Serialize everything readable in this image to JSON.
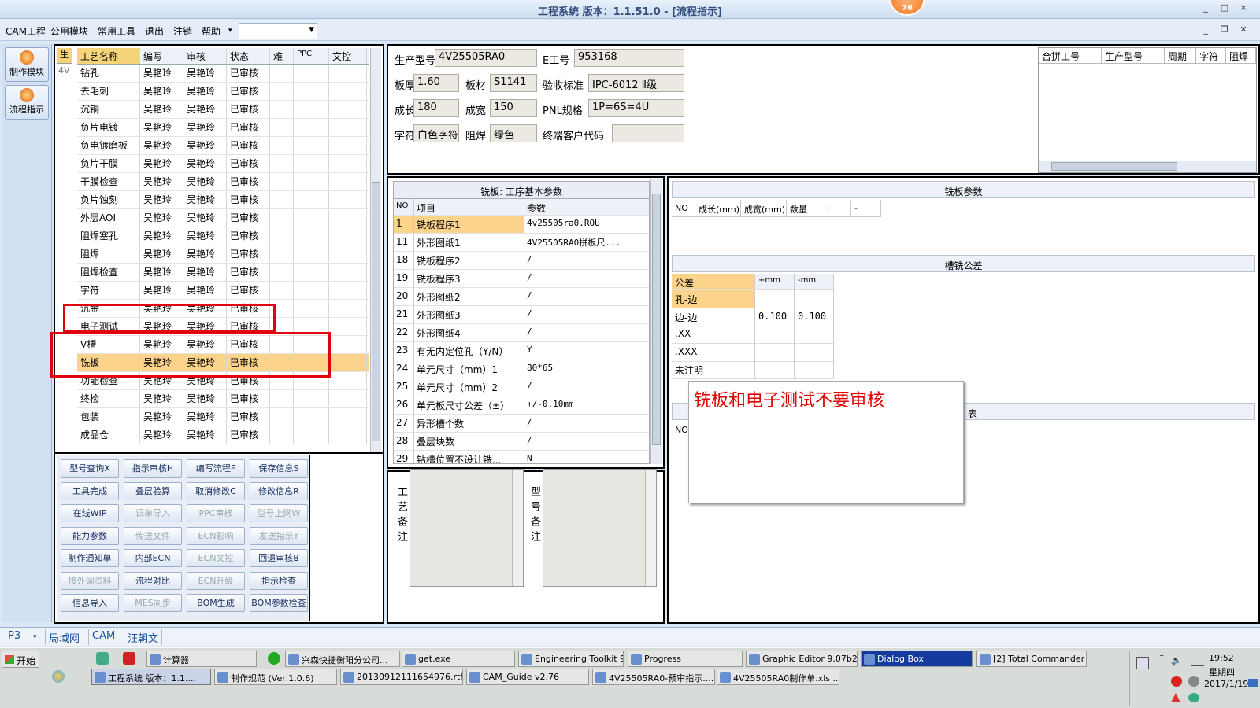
{
  "window": {
    "title": "工程系统    版本：1.1.51.0 - [流程指示]",
    "badge": "76",
    "controls": [
      "_",
      "□",
      "×"
    ]
  },
  "menubar": {
    "items": [
      "CAM工程",
      "公用模块",
      "常用工具",
      "退出",
      "注销",
      "帮助"
    ],
    "combo_value": ""
  },
  "leftbar": {
    "buttons": [
      "制作模块",
      "流程指示"
    ]
  },
  "strip": {
    "head": "生",
    "cell": "4V"
  },
  "process": {
    "headers": [
      "工艺名称",
      "编写",
      "审核",
      "状态",
      "难",
      "PPC",
      "文控"
    ],
    "rows": [
      [
        "钻孔",
        "吴艳玲",
        "吴艳玲",
        "已审核"
      ],
      [
        "去毛刺",
        "吴艳玲",
        "吴艳玲",
        "已审核"
      ],
      [
        "沉铜",
        "吴艳玲",
        "吴艳玲",
        "已审核"
      ],
      [
        "负片电镀",
        "吴艳玲",
        "吴艳玲",
        "已审核"
      ],
      [
        "负电镀磨板",
        "吴艳玲",
        "吴艳玲",
        "已审核"
      ],
      [
        "负片干膜",
        "吴艳玲",
        "吴艳玲",
        "已审核"
      ],
      [
        "干膜检查",
        "吴艳玲",
        "吴艳玲",
        "已审核"
      ],
      [
        "负片蚀刻",
        "吴艳玲",
        "吴艳玲",
        "已审核"
      ],
      [
        "外层AOI",
        "吴艳玲",
        "吴艳玲",
        "已审核"
      ],
      [
        "阻焊塞孔",
        "吴艳玲",
        "吴艳玲",
        "已审核"
      ],
      [
        "阻焊",
        "吴艳玲",
        "吴艳玲",
        "已审核"
      ],
      [
        "阻焊检查",
        "吴艳玲",
        "吴艳玲",
        "已审核"
      ],
      [
        "字符",
        "吴艳玲",
        "吴艳玲",
        "已审核"
      ],
      [
        "沉金",
        "吴艳玲",
        "吴艳玲",
        "已审核"
      ],
      [
        "电子测试",
        "吴艳玲",
        "吴艳玲",
        "已审核"
      ],
      [
        "V槽",
        "吴艳玲",
        "吴艳玲",
        "已审核"
      ],
      [
        "铣板",
        "吴艳玲",
        "吴艳玲",
        "已审核"
      ],
      [
        "功能检查",
        "吴艳玲",
        "吴艳玲",
        "已审核"
      ],
      [
        "终检",
        "吴艳玲",
        "吴艳玲",
        "已审核"
      ],
      [
        "包装",
        "吴艳玲",
        "吴艳玲",
        "已审核"
      ],
      [
        "成品仓",
        "吴艳玲",
        "吴艳玲",
        "已审核"
      ]
    ],
    "selected_row": "铣板"
  },
  "actions": [
    [
      "型号查询X",
      "指示审核H",
      "编写流程F",
      "保存信息S"
    ],
    [
      "工具完成",
      "叠层验算",
      "取消修改C",
      "修改信息R"
    ],
    [
      "在线WIP",
      "调单导入",
      "PPC审核",
      "型号上网W"
    ],
    [
      "能力参数",
      "传送文件",
      "ECN影响",
      "发送指示Y"
    ],
    [
      "制作通知单",
      "内部ECN",
      "ECN文控",
      "回退审核B"
    ],
    [
      "接外调资料",
      "流程对比",
      "ECN升级",
      "指示检查"
    ],
    [
      "信息导入",
      "MES同步",
      "BOM生成",
      "BOM参数检查"
    ]
  ],
  "actions_disabled": [
    "调单导入",
    "PPC审核",
    "型号上网W",
    "传送文件",
    "ECN影响",
    "发送指示Y",
    "ECN文控",
    "接外调资料",
    "ECN升级",
    "MES同步"
  ],
  "info": {
    "product_model_label": "生产型号",
    "product_model": "4V25505RA0",
    "e_no_label": "E工号",
    "e_no": "953168",
    "thickness_label": "板厚",
    "thickness": "1.60",
    "material_label": "板材",
    "material": "S1141",
    "standard_label": "验收标准",
    "standard": "IPC-6012 Ⅱ级",
    "length_label": "成长",
    "length": "180",
    "width_label": "成宽",
    "width": "150",
    "pnl_label": "PNL规格",
    "pnl": "1P=6S=4U",
    "char_label": "字符",
    "char": "白色字符",
    "mask_label": "阻焊",
    "mask": "绿色",
    "customer_label": "终端客户代码",
    "customer": ""
  },
  "merge_grid": {
    "headers": [
      "合拼工号",
      "生产型号",
      "周期",
      "字符",
      "阻焊"
    ]
  },
  "params": {
    "title": "铣板: 工序基本参数",
    "headers": [
      "NO",
      "项目",
      "参数"
    ],
    "rows": [
      [
        "1",
        "铣板程序1",
        "4v25505ra0.ROU"
      ],
      [
        "11",
        "外形图纸1",
        "4V25505RA0拼板尺..."
      ],
      [
        "18",
        "铣板程序2",
        "/"
      ],
      [
        "19",
        "铣板程序3",
        "/"
      ],
      [
        "20",
        "外形图纸2",
        "/"
      ],
      [
        "21",
        "外形图纸3",
        "/"
      ],
      [
        "22",
        "外形图纸4",
        "/"
      ],
      [
        "23",
        "有无内定位孔（Y/N）",
        "Y"
      ],
      [
        "24",
        "单元尺寸（mm）1",
        "80*65"
      ],
      [
        "25",
        "单元尺寸（mm）2",
        "/"
      ],
      [
        "26",
        "单元板尺寸公差（±）",
        "+/-0.10mm"
      ],
      [
        "27",
        "异形槽个数",
        "/"
      ],
      [
        "28",
        "叠层块数",
        "/"
      ],
      [
        "29",
        "钻槽位置不设计铣...",
        "N"
      ]
    ]
  },
  "remarks": {
    "process_label": "工艺备注",
    "model_label": "型号备注"
  },
  "mill_params": {
    "title": "铣板参数",
    "headers": [
      "NO",
      "成长(mm)",
      "成宽(mm)",
      "数量",
      "+",
      "-"
    ]
  },
  "slot_tol": {
    "title": "槽铣公差",
    "headers": [
      "公差",
      "+mm",
      "-mm"
    ],
    "rows": [
      [
        "孔-边",
        "",
        ""
      ],
      [
        "边-边",
        "0.100",
        "0.100"
      ],
      [
        ".XX",
        "",
        ""
      ],
      [
        ".XXX",
        "",
        ""
      ],
      [
        "未注明",
        "",
        ""
      ]
    ]
  },
  "third_section": {
    "title_fragment": "表",
    "col_fragment": "NO"
  },
  "note": "铣板和电子测试不要审核",
  "tabs": {
    "combo": "P3",
    "items": [
      "局域网",
      "CAM",
      "汪朝文"
    ]
  },
  "taskbar": {
    "start": "开始",
    "row1": [
      "计算器",
      "兴森快捷衡阳分公司...",
      "get.exe",
      "Engineering Toolkit 9....",
      "Progress",
      "Graphic Editor 9.07b2 ...",
      "Dialog Box",
      "[2] Total Commander ..."
    ],
    "row2": [
      "工程系统  版本：1.1....",
      "制作规范 (Ver:1.0.6)",
      "20130912111654976.rtf...",
      "CAM_Guide v2.76",
      "4V25505RA0-预审指示....",
      "4V25505RA0制作单.xls ..."
    ],
    "clock": "19:52",
    "weekday": "星期四",
    "date": "2017/1/19"
  },
  "colors": {
    "selected_row": "#fbd38a",
    "highlight_box": "#e00010",
    "note_text": "#e00000"
  }
}
